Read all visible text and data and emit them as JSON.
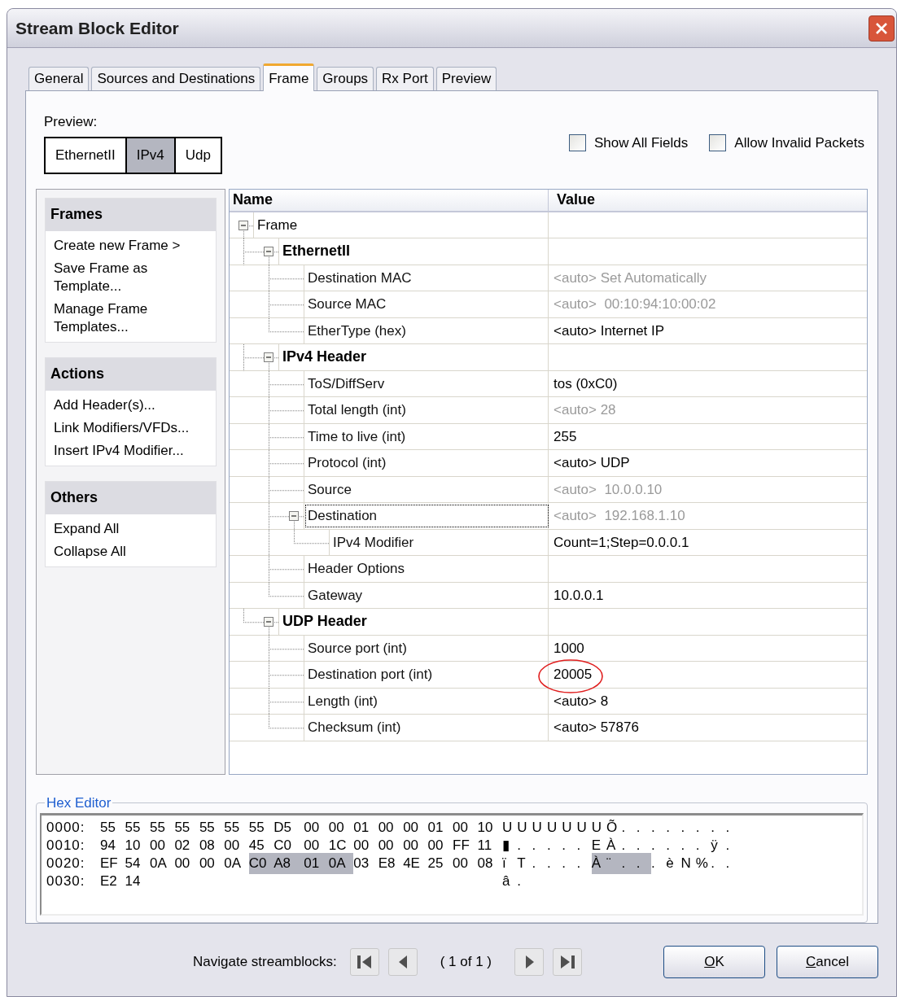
{
  "window": {
    "title": "Stream Block Editor"
  },
  "tabs": [
    {
      "label": "General",
      "selected": false
    },
    {
      "label": "Sources and Destinations",
      "selected": false
    },
    {
      "label": "Frame",
      "selected": true
    },
    {
      "label": "Groups",
      "selected": false
    },
    {
      "label": "Rx Port",
      "selected": false
    },
    {
      "label": "Preview",
      "selected": false
    }
  ],
  "preview": {
    "label": "Preview:",
    "segments": [
      {
        "label": "EthernetII",
        "selected": false
      },
      {
        "label": "IPv4",
        "selected": true
      },
      {
        "label": "Udp",
        "selected": false
      }
    ]
  },
  "options": [
    {
      "label": "Show All Fields",
      "checked": false
    },
    {
      "label": "Allow Invalid Packets",
      "checked": false
    }
  ],
  "sidebar": [
    {
      "title": "Frames",
      "items": [
        "Create new Frame >",
        "Save Frame as Template...",
        "Manage Frame Templates..."
      ]
    },
    {
      "title": "Actions",
      "items": [
        "Add Header(s)...",
        "Link Modifiers/VFDs...",
        "Insert IPv4 Modifier..."
      ]
    },
    {
      "title": "Others",
      "items": [
        "Expand All",
        "Collapse All"
      ]
    }
  ],
  "tree": {
    "columns": [
      "Name",
      "Value"
    ],
    "nodes": [
      {
        "kind": "root",
        "name": "Frame",
        "expanded": true,
        "children": [
          {
            "kind": "header",
            "name": "EthernetII",
            "expanded": true,
            "children": [
              {
                "kind": "field",
                "name": "Destination MAC",
                "value": "<auto> Set Automatically",
                "dimmed": true
              },
              {
                "kind": "field",
                "name": "Source MAC",
                "value": "<auto>  00:10:94:10:00:02",
                "dimmed": true
              },
              {
                "kind": "field",
                "name": "EtherType (hex)",
                "value": "<auto> Internet IP",
                "dimmed": false
              }
            ]
          },
          {
            "kind": "header",
            "name": "IPv4 Header",
            "expanded": true,
            "children": [
              {
                "kind": "field",
                "name": "ToS/DiffServ",
                "value": "tos (0xC0)",
                "dimmed": false
              },
              {
                "kind": "field",
                "name": "Total length (int)",
                "value": "<auto> 28",
                "dimmed": true
              },
              {
                "kind": "field",
                "name": "Time to live (int)",
                "value": "255",
                "dimmed": false
              },
              {
                "kind": "field",
                "name": "Protocol (int)",
                "value": "<auto> UDP",
                "dimmed": false
              },
              {
                "kind": "field",
                "name": "Source",
                "value": "<auto>  10.0.0.10",
                "dimmed": true
              },
              {
                "kind": "field",
                "name": "Destination",
                "value": "<auto>  192.168.1.10",
                "dimmed": true,
                "focused": true,
                "expanded": true,
                "children": [
                  {
                    "kind": "field",
                    "name": "IPv4 Modifier",
                    "value": "Count=1;Step=0.0.0.1",
                    "dimmed": false
                  }
                ]
              },
              {
                "kind": "field",
                "name": "Header Options"
              },
              {
                "kind": "field",
                "name": "Gateway",
                "value": "10.0.0.1",
                "dimmed": false
              }
            ]
          },
          {
            "kind": "header",
            "name": "UDP Header",
            "expanded": true,
            "children": [
              {
                "kind": "field",
                "name": "Source port (int)",
                "value": "1000",
                "dimmed": false
              },
              {
                "kind": "field",
                "name": "Destination port (int)",
                "value": "20005",
                "dimmed": false,
                "circled": true
              },
              {
                "kind": "field",
                "name": "Length (int)",
                "value": "<auto> 8",
                "dimmed": false
              },
              {
                "kind": "field",
                "name": "Checksum (int)",
                "value": "<auto> 57876",
                "dimmed": false
              }
            ]
          }
        ]
      }
    ]
  },
  "hex_editor": {
    "title": "Hex Editor",
    "rows": [
      {
        "address": "0000:",
        "bytes": [
          {
            "text": "55",
            "selected": false
          },
          {
            "text": "55",
            "selected": false
          },
          {
            "text": "55",
            "selected": false
          },
          {
            "text": "55",
            "selected": false
          },
          {
            "text": "55",
            "selected": false
          },
          {
            "text": "55",
            "selected": false
          },
          {
            "text": "55",
            "selected": false
          },
          {
            "text": "D5",
            "selected": false
          },
          {
            "text": "00",
            "selected": false
          },
          {
            "text": "00",
            "selected": false
          },
          {
            "text": "01",
            "selected": false
          },
          {
            "text": "00",
            "selected": false
          },
          {
            "text": "00",
            "selected": false
          },
          {
            "text": "01",
            "selected": false
          },
          {
            "text": "00",
            "selected": false
          },
          {
            "text": "10",
            "selected": false
          }
        ],
        "ascii": [
          {
            "text": "U",
            "selected": false
          },
          {
            "text": "U",
            "selected": false
          },
          {
            "text": "U",
            "selected": false
          },
          {
            "text": "U",
            "selected": false
          },
          {
            "text": "U",
            "selected": false
          },
          {
            "text": "U",
            "selected": false
          },
          {
            "text": "U",
            "selected": false
          },
          {
            "text": "Õ",
            "selected": false
          },
          {
            "text": ".",
            "selected": false
          },
          {
            "text": ".",
            "selected": false
          },
          {
            "text": ".",
            "selected": false
          },
          {
            "text": ".",
            "selected": false
          },
          {
            "text": ".",
            "selected": false
          },
          {
            "text": ".",
            "selected": false
          },
          {
            "text": ".",
            "selected": false
          },
          {
            "text": ".",
            "selected": false
          }
        ]
      },
      {
        "address": "0010:",
        "bytes": [
          {
            "text": "94",
            "selected": false
          },
          {
            "text": "10",
            "selected": false
          },
          {
            "text": "00",
            "selected": false
          },
          {
            "text": "02",
            "selected": false
          },
          {
            "text": "08",
            "selected": false
          },
          {
            "text": "00",
            "selected": false
          },
          {
            "text": "45",
            "selected": false
          },
          {
            "text": "C0",
            "selected": false
          },
          {
            "text": "00",
            "selected": false
          },
          {
            "text": "1C",
            "selected": false
          },
          {
            "text": "00",
            "selected": false
          },
          {
            "text": "00",
            "selected": false
          },
          {
            "text": "00",
            "selected": false
          },
          {
            "text": "00",
            "selected": false
          },
          {
            "text": "FF",
            "selected": false
          },
          {
            "text": "11",
            "selected": false
          }
        ],
        "ascii": [
          {
            "text": "▮",
            "selected": false
          },
          {
            "text": ".",
            "selected": false
          },
          {
            "text": ".",
            "selected": false
          },
          {
            "text": ".",
            "selected": false
          },
          {
            "text": ".",
            "selected": false
          },
          {
            "text": ".",
            "selected": false
          },
          {
            "text": "E",
            "selected": false
          },
          {
            "text": "À",
            "selected": false
          },
          {
            "text": ".",
            "selected": false
          },
          {
            "text": ".",
            "selected": false
          },
          {
            "text": ".",
            "selected": false
          },
          {
            "text": ".",
            "selected": false
          },
          {
            "text": ".",
            "selected": false
          },
          {
            "text": ".",
            "selected": false
          },
          {
            "text": "ÿ",
            "selected": false
          },
          {
            "text": ".",
            "selected": false
          }
        ]
      },
      {
        "address": "0020:",
        "bytes": [
          {
            "text": "EF",
            "selected": false
          },
          {
            "text": "54",
            "selected": false
          },
          {
            "text": "0A",
            "selected": false
          },
          {
            "text": "00",
            "selected": false
          },
          {
            "text": "00",
            "selected": false
          },
          {
            "text": "0A",
            "selected": false
          },
          {
            "text": "C0",
            "selected": true
          },
          {
            "text": "A8",
            "selected": true
          },
          {
            "text": "01",
            "selected": true
          },
          {
            "text": "0A",
            "selected": true
          },
          {
            "text": "03",
            "selected": false
          },
          {
            "text": "E8",
            "selected": false
          },
          {
            "text": "4E",
            "selected": false
          },
          {
            "text": "25",
            "selected": false
          },
          {
            "text": "00",
            "selected": false
          },
          {
            "text": "08",
            "selected": false
          }
        ],
        "ascii": [
          {
            "text": "ï",
            "selected": false
          },
          {
            "text": "T",
            "selected": false
          },
          {
            "text": ".",
            "selected": false
          },
          {
            "text": ".",
            "selected": false
          },
          {
            "text": ".",
            "selected": false
          },
          {
            "text": ".",
            "selected": false
          },
          {
            "text": "À",
            "selected": true
          },
          {
            "text": "¨",
            "selected": true
          },
          {
            "text": ".",
            "selected": true
          },
          {
            "text": ".",
            "selected": true
          },
          {
            "text": ".",
            "selected": false
          },
          {
            "text": "è",
            "selected": false
          },
          {
            "text": "N",
            "selected": false
          },
          {
            "text": "%",
            "selected": false
          },
          {
            "text": ".",
            "selected": false
          },
          {
            "text": ".",
            "selected": false
          }
        ]
      },
      {
        "address": "0030:",
        "bytes": [
          {
            "text": "E2",
            "selected": false
          },
          {
            "text": "14",
            "selected": false
          }
        ],
        "ascii": [
          {
            "text": "â",
            "selected": false
          },
          {
            "text": ".",
            "selected": false
          }
        ]
      }
    ]
  },
  "navigation": {
    "label": "Navigate streamblocks:",
    "position": "( 1 of 1 )"
  },
  "buttons": [
    {
      "label": "OK"
    },
    {
      "label": "Cancel"
    }
  ]
}
